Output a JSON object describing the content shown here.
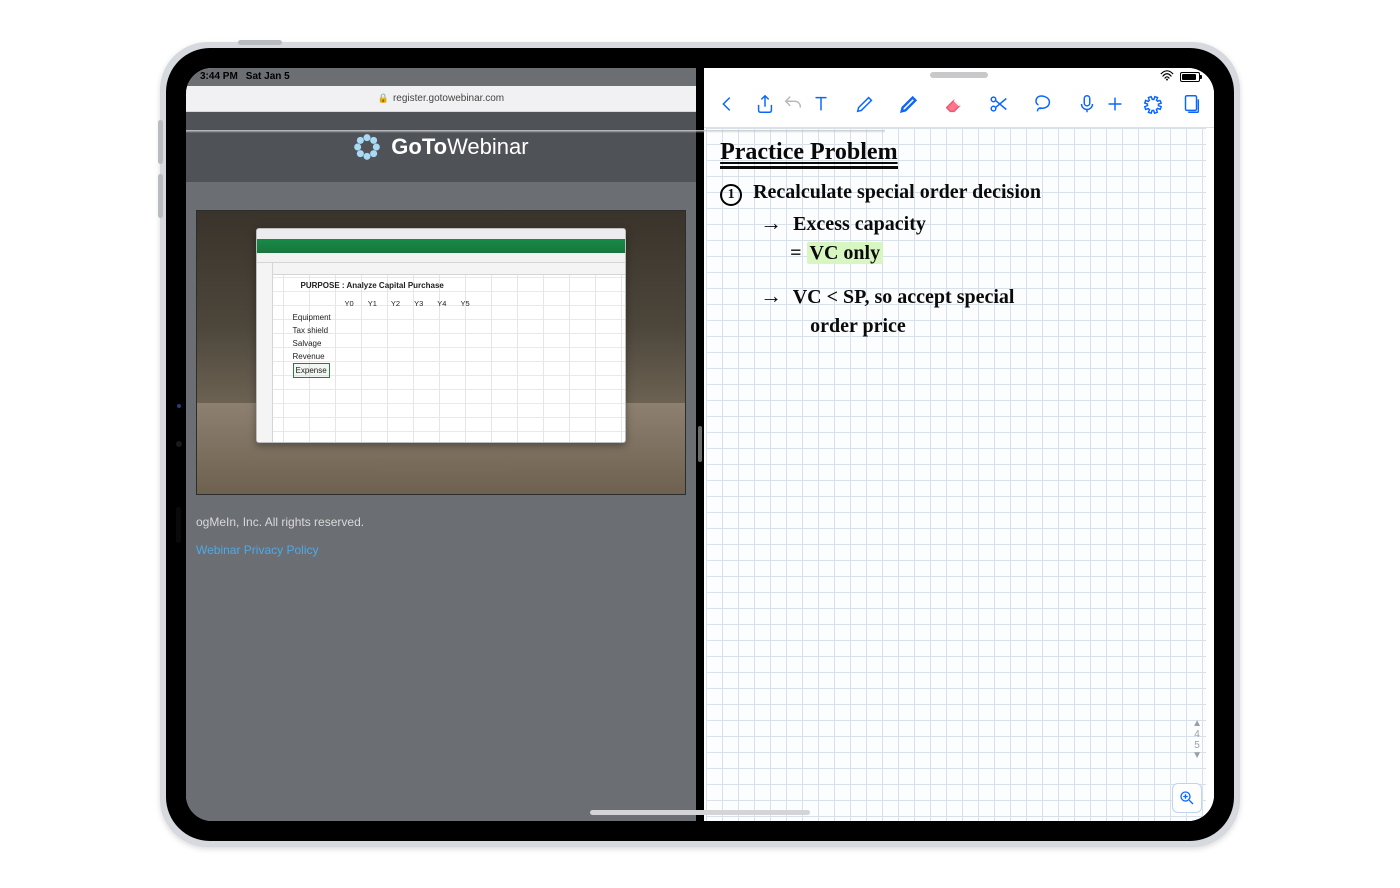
{
  "status": {
    "time": "3:44 PM",
    "date": "Sat Jan 5"
  },
  "safari": {
    "url": "register.gotowebinar.com"
  },
  "gotowebinar": {
    "brand_prefix": "GoTo",
    "brand_suffix": "Webinar",
    "spreadsheet": {
      "purpose": "PURPOSE : Analyze Capital Purchase",
      "years": [
        "Y0",
        "Y1",
        "Y2",
        "Y3",
        "Y4",
        "Y5"
      ],
      "rows": [
        "Equipment",
        "Tax shield",
        "Salvage",
        "",
        "Revenue",
        "Expense"
      ],
      "selected_row": "Expense"
    },
    "footer": {
      "line1": "ogMeIn, Inc. All rights reserved.",
      "privacy": "Webinar Privacy Policy"
    }
  },
  "notes": {
    "title": "Practice Problem",
    "bullet_number": "1",
    "step1": "Recalculate special order decision",
    "step1a_arrow": "Excess capacity",
    "step1a_eq": "= ",
    "step1a_hl": "VC only",
    "step1b_arrow": "VC < SP, so accept special",
    "step1b_cont": "order price",
    "pages": {
      "cur": "4",
      "total": "5"
    }
  }
}
